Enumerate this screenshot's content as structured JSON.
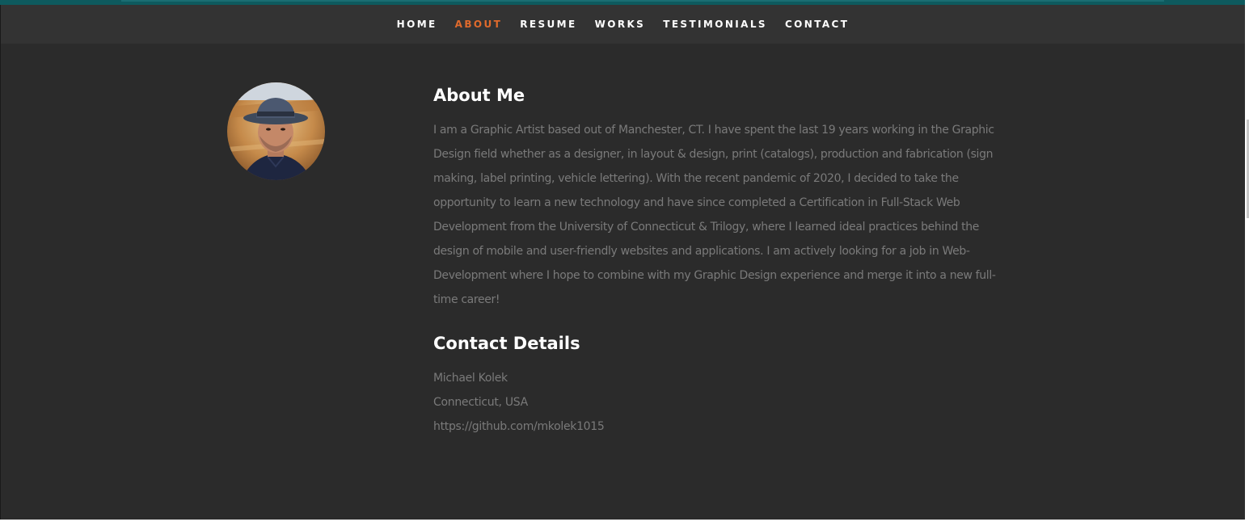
{
  "nav": {
    "items": [
      {
        "label": "HOME",
        "active": false
      },
      {
        "label": "ABOUT",
        "active": true
      },
      {
        "label": "RESUME",
        "active": false
      },
      {
        "label": "WORKS",
        "active": false
      },
      {
        "label": "TESTIMONIALS",
        "active": false
      },
      {
        "label": "CONTACT",
        "active": false
      }
    ]
  },
  "about": {
    "title": "About Me",
    "bio": "I am a Graphic Artist based out of Manchester, CT. I have spent the last 19 years working in the Graphic Design field whether as a designer, in layout & design, print (catalogs), production and fabrication (sign making, label printing, vehicle lettering). With the recent pandemic of 2020, I decided to take the opportunity to learn a new technology and have since completed a Certification in Full-Stack Web Development from the University of Connecticut & Trilogy, where I learned ideal practices behind the design of mobile and user-friendly websites and applications. I am actively looking for a job in Web-Development where I hope to combine with my Graphic Design experience and merge it into a new full-time career!"
  },
  "contact": {
    "title": "Contact Details",
    "name": "Michael Kolek",
    "location": "Connecticut, USA",
    "github": "https://github.com/mkolek1015"
  },
  "colors": {
    "accent": "#e06a2c",
    "nav_bg": "#333333",
    "section_bg": "#2b2b2b",
    "text_muted": "#7a7a7a",
    "heading": "#ffffff"
  }
}
